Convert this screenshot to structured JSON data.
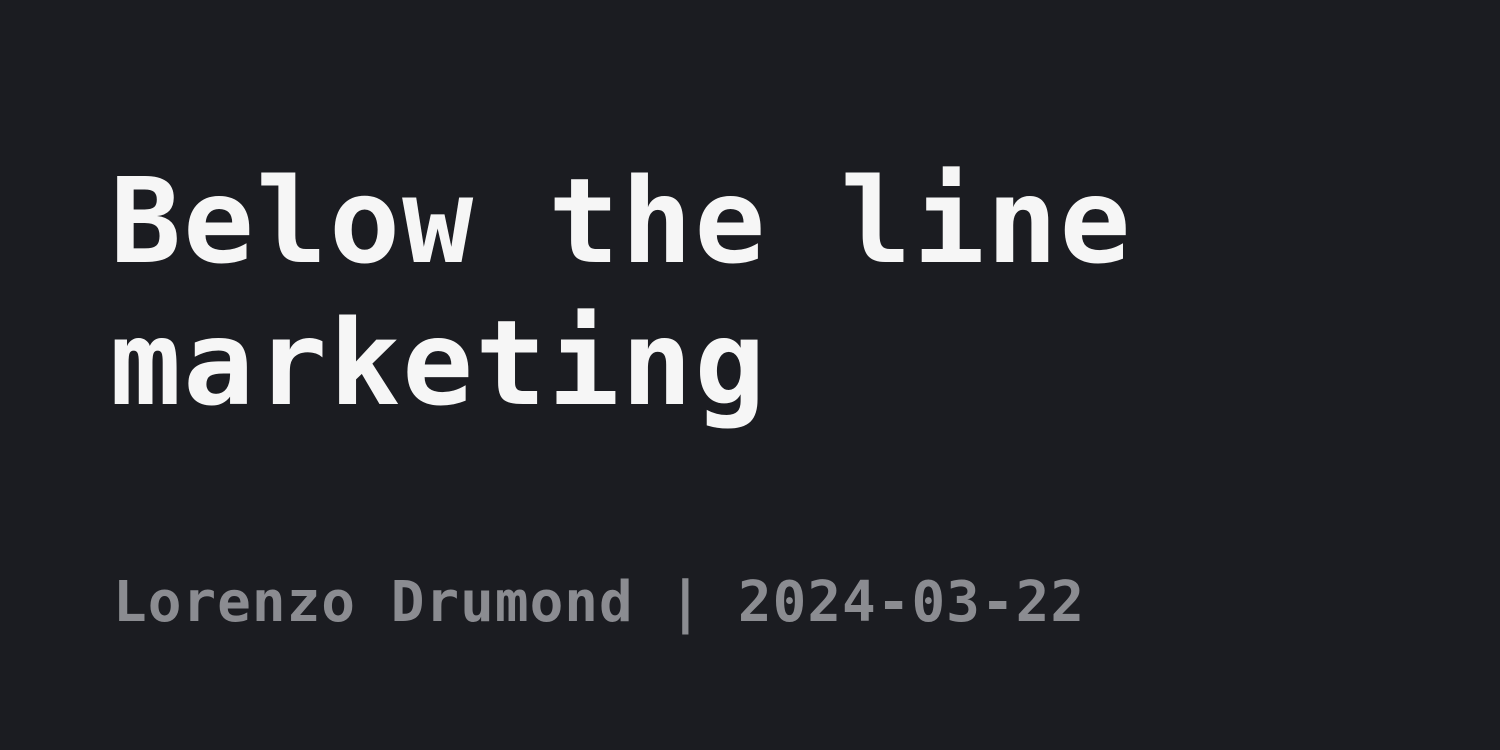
{
  "post": {
    "title": "Below the line marketing",
    "author": "Lorenzo Drumond",
    "separator": "|",
    "date": "2024-03-22"
  },
  "colors": {
    "background": "#1b1c21",
    "title": "#f6f6f6",
    "meta": "#8b8c91"
  }
}
